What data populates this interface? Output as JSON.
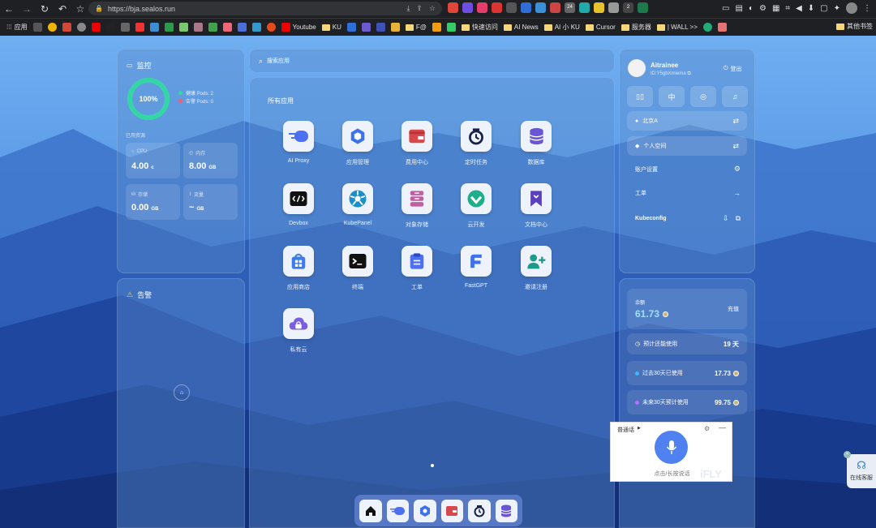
{
  "browser": {
    "url": "https://bja.sealos.run",
    "ext_badge_1": "24",
    "ext_badge_2": "2"
  },
  "bookmarks": {
    "apps": "应用",
    "youtube": "Youtube",
    "ku": "KU",
    "f_at": "F@",
    "quick": "快速访问",
    "ainews": "AI News",
    "aiku": "AI 小 KU",
    "cursor": "Cursor",
    "server": "服务器",
    "wall": "| WALL >>",
    "other": "其他书签"
  },
  "monitor": {
    "title": "监控",
    "percent": "100%",
    "healthy": "健康 Pods: 2",
    "alert": "告警 Pods: 0",
    "used_title": "已用资源",
    "cpu_label": "CPU",
    "cpu_value": "4.00",
    "cpu_unit": "c",
    "mem_label": "内存",
    "mem_value": "8.00",
    "mem_unit": "GB",
    "storage_label": "存储",
    "storage_value": "0.00",
    "storage_unit": "GB",
    "traffic_label": "流量",
    "traffic_value": "~",
    "traffic_unit": "GB",
    "healthy_fraction": 1.0
  },
  "alerts": {
    "title": "告警"
  },
  "search": {
    "placeholder": "搜索应用"
  },
  "apps": {
    "title": "所有应用",
    "items": [
      {
        "label": "AI Proxy",
        "icon": "ai-proxy-icon"
      },
      {
        "label": "应用管理",
        "icon": "app-manage-icon"
      },
      {
        "label": "费用中心",
        "icon": "cost-center-icon"
      },
      {
        "label": "定时任务",
        "icon": "cronjob-icon"
      },
      {
        "label": "数据库",
        "icon": "database-icon"
      },
      {
        "label": "Devbox",
        "icon": "devbox-icon"
      },
      {
        "label": "KubePanel",
        "icon": "kubepanel-icon"
      },
      {
        "label": "对象存储",
        "icon": "object-storage-icon"
      },
      {
        "label": "云开发",
        "icon": "cloud-dev-icon"
      },
      {
        "label": "文档中心",
        "icon": "docs-icon"
      },
      {
        "label": "应用商店",
        "icon": "app-store-icon"
      },
      {
        "label": "终端",
        "icon": "terminal-icon"
      },
      {
        "label": "工单",
        "icon": "workorder-icon"
      },
      {
        "label": "FastGPT",
        "icon": "fastgpt-icon"
      },
      {
        "label": "邀请注册",
        "icon": "invite-icon"
      },
      {
        "label": "私有云",
        "icon": "private-cloud-icon"
      }
    ]
  },
  "user": {
    "name": "Aitrainee",
    "id": "ID:Y5gbXmiema",
    "logout": "登出",
    "lang": "中",
    "region": "北京A",
    "workspace": "个人空间",
    "account_settings": "账户设置",
    "workorder": "工单",
    "kubeconfig": "Kubeconfig"
  },
  "billing": {
    "balance_label": "余额",
    "balance": "61.73",
    "recharge": "充值",
    "days_label": "预计还能使用",
    "days": "19 天",
    "past_label": "过去30天已使用",
    "past_value": "17.73",
    "future_label": "未来30天预计使用",
    "future_value": "99.75"
  },
  "voice": {
    "mode": "普通话",
    "hint": "点击/长按说话",
    "brand": "iFLY"
  },
  "support": {
    "label": "在线客服"
  }
}
